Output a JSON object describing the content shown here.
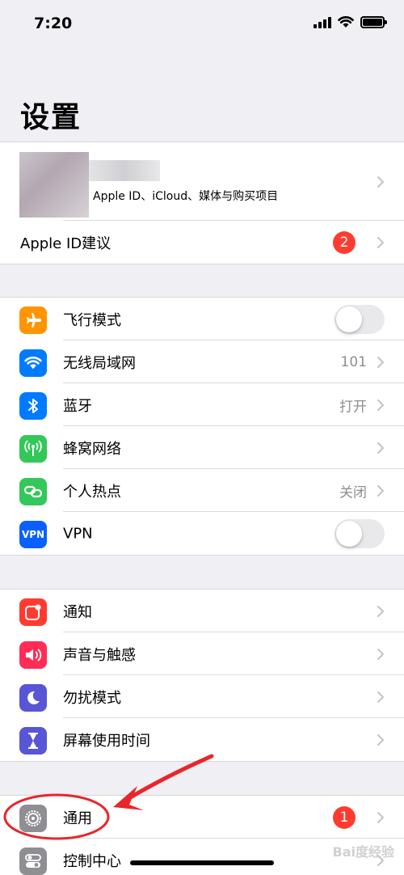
{
  "status_bar": {
    "time": "7:20"
  },
  "page_title": "设置",
  "profile": {
    "subtitle": "Apple ID、iCloud、媒体与购买项目",
    "suggestion_label": "Apple ID建议",
    "suggestion_badge": "2"
  },
  "connectivity": {
    "items": [
      {
        "label": "飞行模式",
        "icon": "airplane-icon",
        "color": "#ff9500",
        "toggle": false
      },
      {
        "label": "无线局域网",
        "icon": "wifi-icon",
        "color": "#007aff",
        "value": "101"
      },
      {
        "label": "蓝牙",
        "icon": "bluetooth-icon",
        "color": "#007aff",
        "value": "打开"
      },
      {
        "label": "蜂窝网络",
        "icon": "cellular-icon",
        "color": "#34c759"
      },
      {
        "label": "个人热点",
        "icon": "hotspot-icon",
        "color": "#34c759",
        "value": "关闭"
      },
      {
        "label": "VPN",
        "icon": "vpn-icon",
        "icon_text": "VPN",
        "color": "#0a60ff",
        "toggle": false
      }
    ]
  },
  "notifications": {
    "items": [
      {
        "label": "通知",
        "icon": "notifications-icon",
        "color": "#ff3b30"
      },
      {
        "label": "声音与触感",
        "icon": "speaker-icon",
        "color": "#ff2d55"
      },
      {
        "label": "勿扰模式",
        "icon": "moon-icon",
        "color": "#5856d6"
      },
      {
        "label": "屏幕使用时间",
        "icon": "hourglass-icon",
        "color": "#5856d6"
      }
    ]
  },
  "general": {
    "items": [
      {
        "label": "通用",
        "icon": "gear-icon",
        "color": "#8e8e93",
        "badge": "1"
      },
      {
        "label": "控制中心",
        "icon": "control-center-icon",
        "color": "#8e8e93"
      }
    ]
  },
  "watermark": "Bai度经验",
  "annotation_color": "#e8262b"
}
